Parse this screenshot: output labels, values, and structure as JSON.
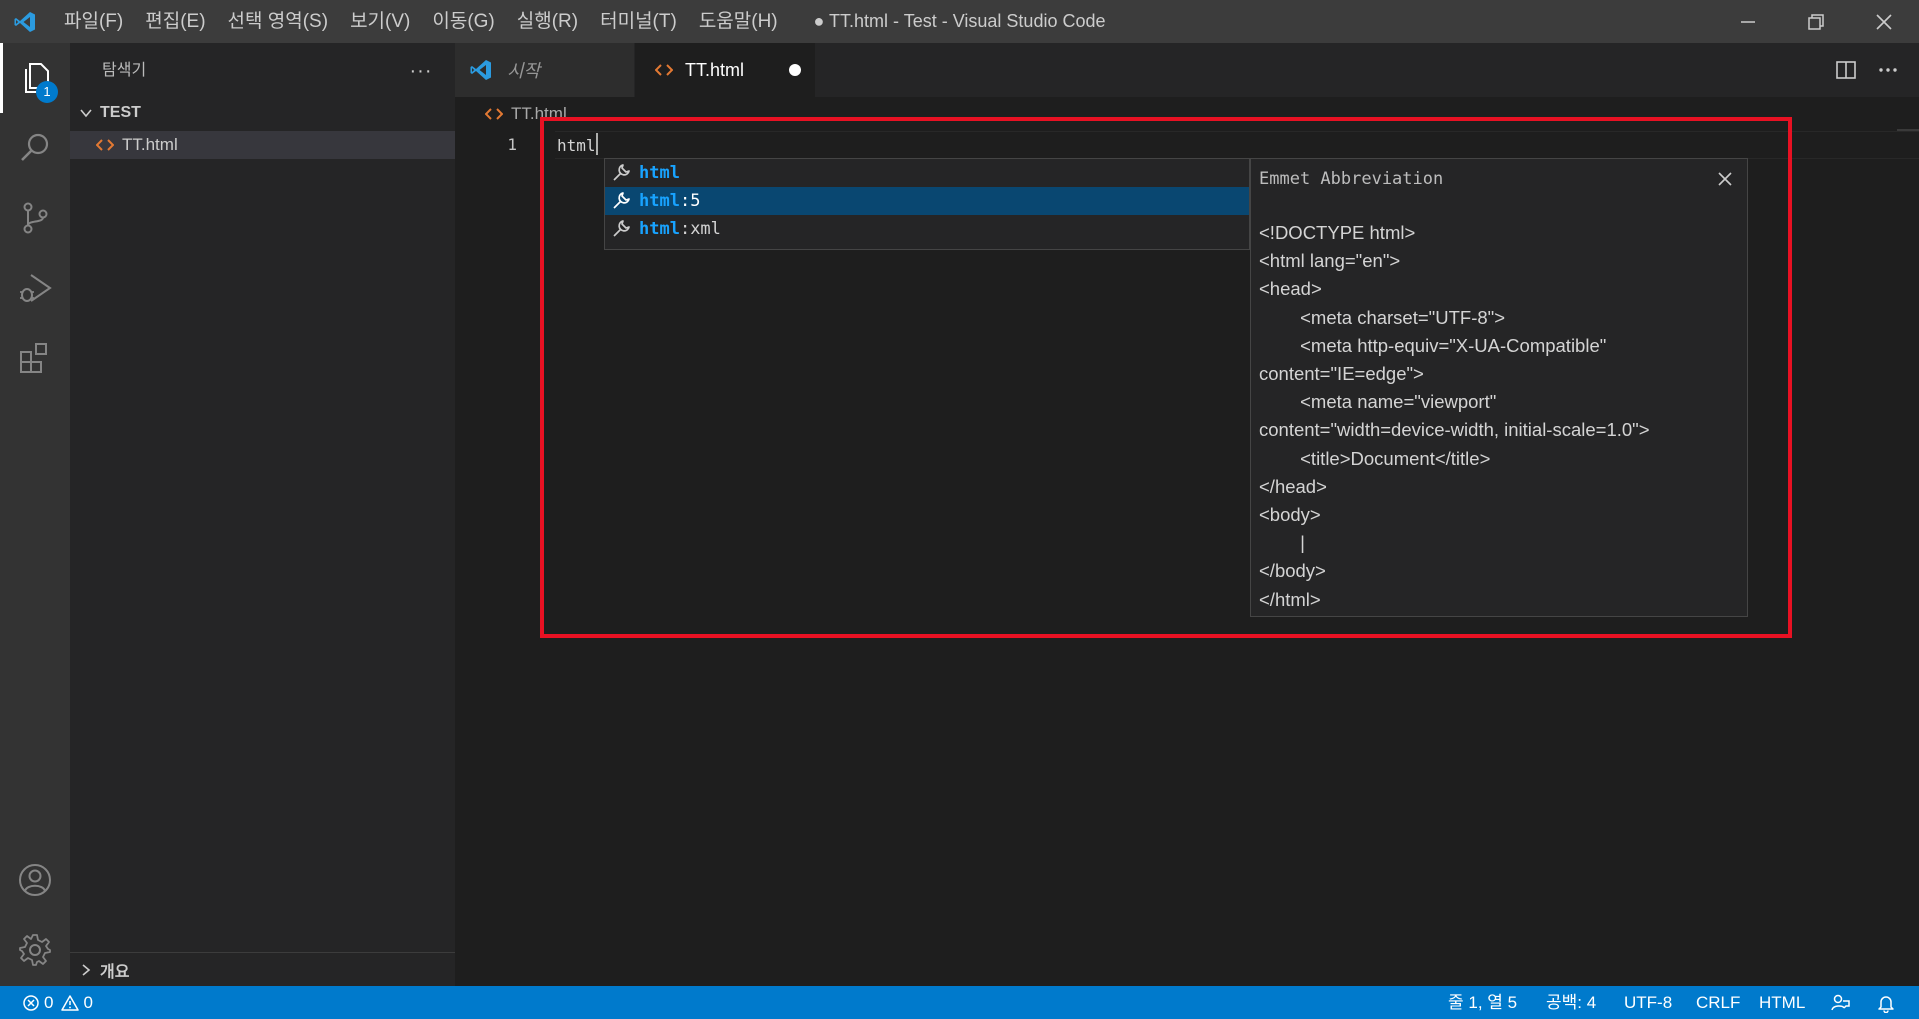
{
  "titlebar": {
    "menu": [
      "파일(F)",
      "편집(E)",
      "선택 영역(S)",
      "보기(V)",
      "이동(G)",
      "실행(R)",
      "터미널(T)",
      "도움말(H)"
    ],
    "title": "● TT.html - Test - Visual Studio Code"
  },
  "activitybar": {
    "explorer_badge": "1",
    "icons": [
      "files-icon",
      "search-icon",
      "source-control-icon",
      "run-debug-icon",
      "extensions-icon",
      "account-icon",
      "settings-gear-icon"
    ]
  },
  "sidebar": {
    "title": "탐색기",
    "more": "···",
    "folder": "TEST",
    "file": "TT.html",
    "outline": "개요"
  },
  "tabs": {
    "start_label": "시작",
    "active_label": "TT.html"
  },
  "breadcrumb": {
    "file": "TT.html"
  },
  "editor": {
    "line_number": "1",
    "line_text": "html"
  },
  "suggest": {
    "items": [
      {
        "match": "html",
        "rest": ""
      },
      {
        "match": "html",
        "rest": ":5"
      },
      {
        "match": "html",
        "rest": ":xml"
      }
    ],
    "selected_index": 1
  },
  "detail": {
    "title": "Emmet Abbreviation",
    "body": "<!DOCTYPE html>\n<html lang=\"en\">\n<head>\n        <meta charset=\"UTF-8\">\n        <meta http-equiv=\"X-UA-Compatible\"\ncontent=\"IE=edge\">\n        <meta name=\"viewport\"\ncontent=\"width=device-width, initial-scale=1.0\">\n        <title>Document</title>\n</head>\n<body>\n        |\n</body>\n</html>"
  },
  "statusbar": {
    "errors": "0",
    "warnings": "0",
    "position": "줄 1, 열 5",
    "spaces": "공백: 4",
    "encoding": "UTF-8",
    "eol": "CRLF",
    "language": "HTML"
  },
  "colors": {
    "accent": "#007acc",
    "highlight_box": "#e81123",
    "suggest_match": "#18a3ff",
    "html_icon": "#e37933"
  }
}
